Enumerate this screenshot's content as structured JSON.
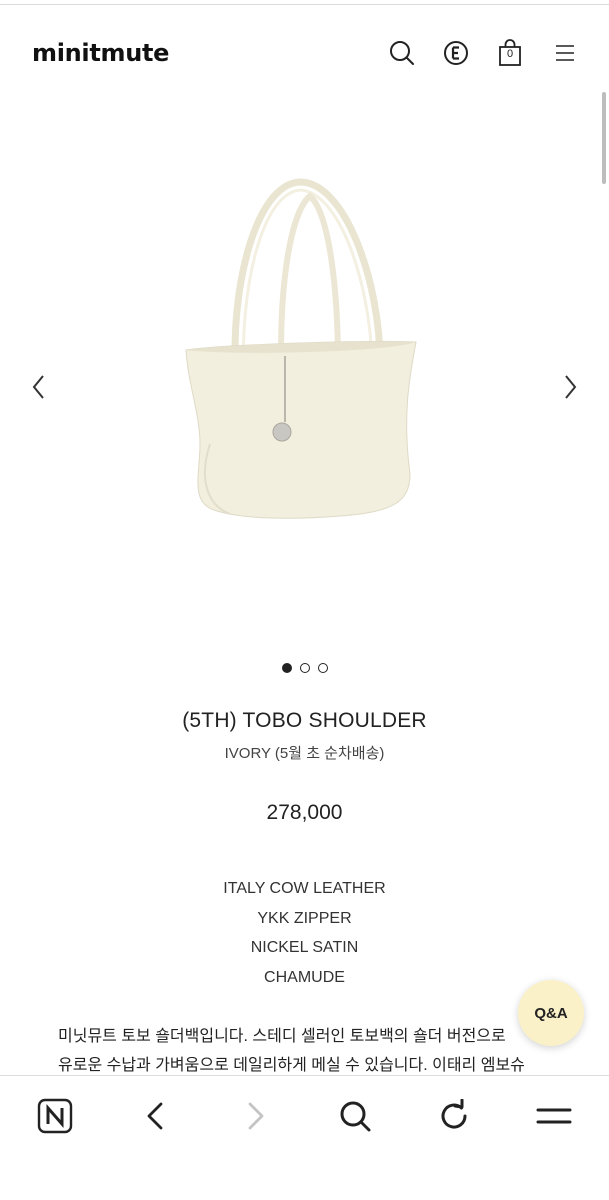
{
  "header": {
    "logo": "minitmute",
    "cart_count": "0"
  },
  "carousel": {
    "image_description_icon": "bag-image",
    "slides_total": 3,
    "active_slide": 1
  },
  "product": {
    "title": "(5TH) TOBO SHOULDER",
    "subtitle": "IVORY (5월 초 순차배송)",
    "price": "278,000",
    "specs": [
      "ITALY COW LEATHER",
      "YKK ZIPPER",
      "NICKEL SATIN",
      "CHAMUDE"
    ],
    "description_lines": [
      "미닛뮤트 토보 숄더백입니다. 스테디 셀러인 토보백의 숄더 버전으로",
      "유로운 수납과 가벼움으로 데일리하게 메실 수 있습니다. 이태리 엠보슈"
    ]
  },
  "qa_button": {
    "label": "Q&A"
  },
  "colors": {
    "qa_background": "#fbf1c8",
    "bag_ivory": "#f1eddc",
    "text": "#222222"
  },
  "bottom_nav": {
    "icons": [
      "naver-home-icon",
      "back-arrow-icon",
      "forward-arrow-icon",
      "search-icon",
      "refresh-icon",
      "menu-icon"
    ]
  }
}
